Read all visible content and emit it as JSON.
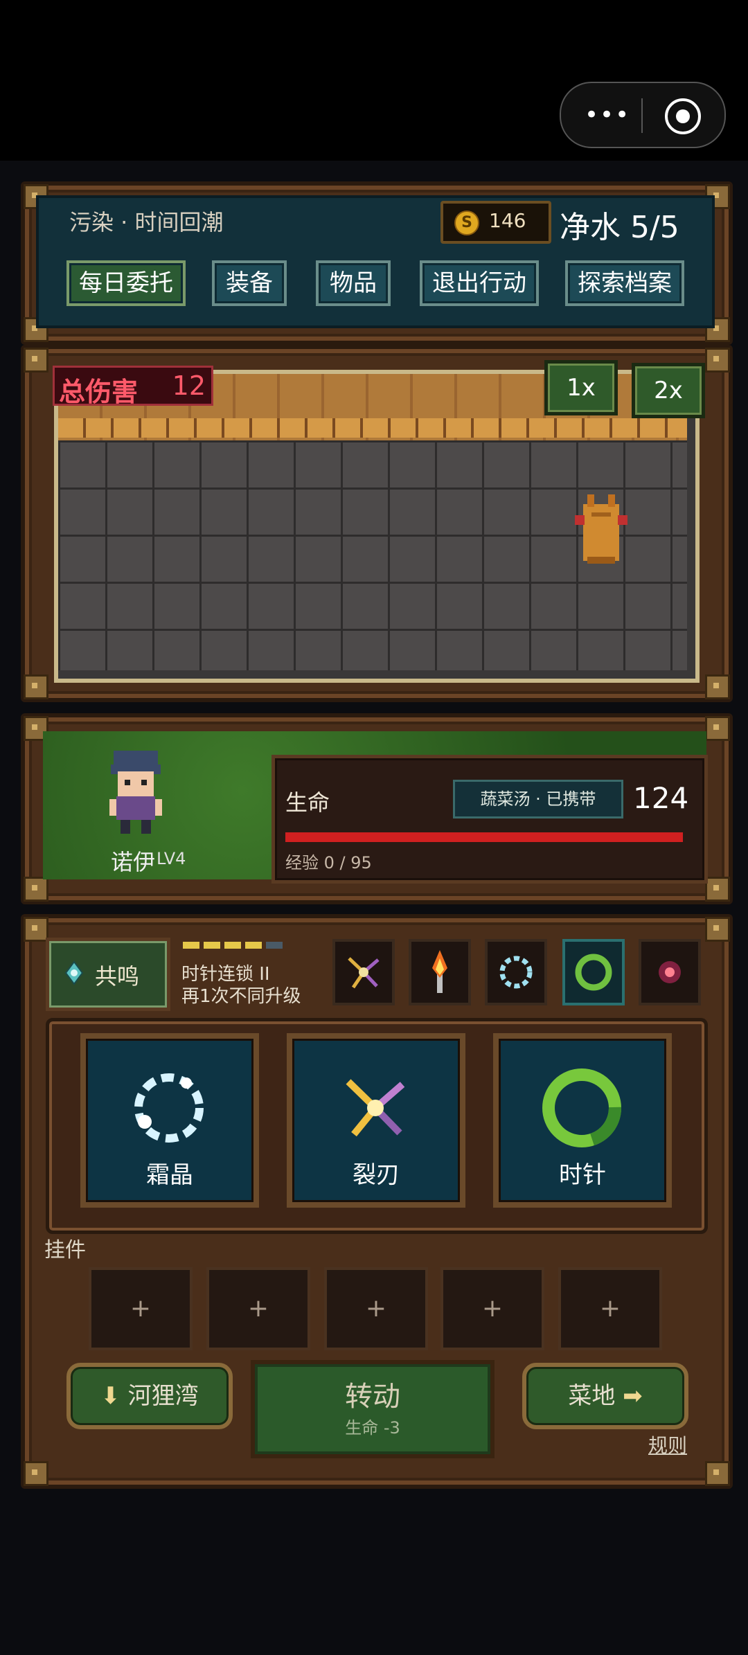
{
  "header": {
    "location": "污染 · 时间回潮",
    "coins": "146",
    "water": "净水 5/5",
    "buttons": [
      "每日委托",
      "装备",
      "物品",
      "退出行动",
      "探索档案"
    ]
  },
  "battle": {
    "damage_label": "总伤害",
    "damage_value": "12",
    "speed_buttons": [
      "1x",
      "2x"
    ]
  },
  "hero": {
    "name": "诺伊",
    "level": "LV4",
    "hp_label": "生命",
    "carried": "蔬菜汤 · 已携带",
    "hp_value": "124",
    "exp": "经验 0 / 95",
    "hp_fraction": 1.0
  },
  "skills": {
    "resonate_label": "共鸣",
    "chain_title": "时针连锁 II",
    "chain_hint": "再1次不同升级",
    "pips_filled": 4,
    "pips_total": 5,
    "cards": [
      "霜晶",
      "裂刃",
      "时针"
    ],
    "attachment_label": "挂件",
    "attachment_slot": "+",
    "left_nav": "河狸湾",
    "right_nav": "菜地",
    "rotate_label": "转动",
    "rotate_cost": "生命 -3",
    "rules": "规则"
  },
  "colors": {
    "hp": "#d02020",
    "pip_on": "#e6c84a",
    "pip_off": "#4a5a66"
  }
}
